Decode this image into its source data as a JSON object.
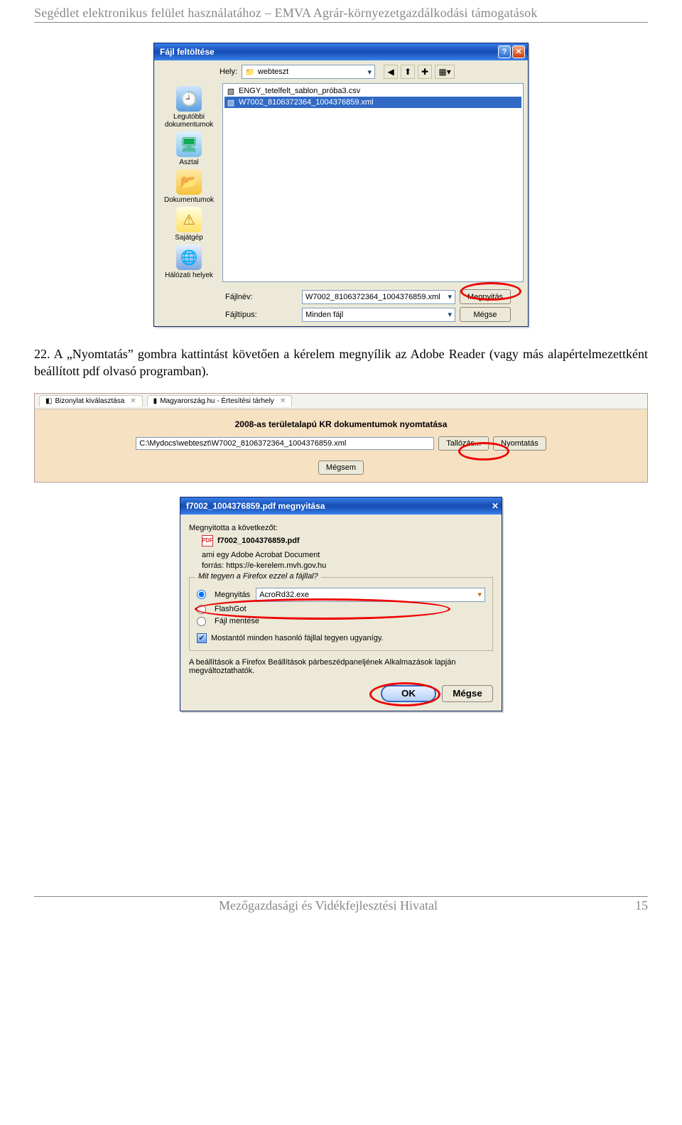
{
  "header": "Segédlet elektronikus felület használatához – EMVA Agrár-környezetgazdálkodási támogatások",
  "paragraph": "22. A „Nyomtatás” gombra kattintást követően a kérelem megnyílik az Adobe Reader (vagy más alapértelmezettként beállított pdf olvasó programban).",
  "footer": {
    "org": "Mezőgazdasági és Vidékfejlesztési Hivatal",
    "page": "15"
  },
  "xp": {
    "title": "Fájl feltöltése",
    "location_label": "Hely:",
    "location_value": "webteszt",
    "places": {
      "recent": "Legutóbbi dokumentumok",
      "desktop": "Asztal",
      "docs": "Dokumentumok",
      "mycomp": "Sajátgép",
      "net": "Hálózati helyek"
    },
    "files": [
      "ENGY_tetelfelt_sablon_próba3.csv",
      "W7002_8106372364_1004376859.xml"
    ],
    "filename_label": "Fájlnév:",
    "filetype_label": "Fájltípus:",
    "filename_value": "W7002_8106372364_1004376859.xml",
    "filetype_value": "Minden fájl",
    "open_btn": "Megnyitás",
    "cancel_btn": "Mégse"
  },
  "web": {
    "tab1": "Bizonylat kiválasztása",
    "tab2": "Magyarország.hu - Értesítési tárhely",
    "title": "2008-as területalapú KR dokumentumok nyomtatása",
    "path": "C:\\Mydocs\\webteszt\\W7002_8106372364_1004376859.xml",
    "browse": "Tallózás...",
    "print": "Nyomtatás",
    "cancel": "Mégsem"
  },
  "ff": {
    "title": "f7002_1004376859.pdf megnyitása",
    "opened_label": "Megnyitotta a következőt:",
    "filename": "f7002_1004376859.pdf",
    "type_prefix": "ami egy",
    "type_value": "Adobe Acrobat Document",
    "source_prefix": "forrás:",
    "source_value": "https://e-kerelem.mvh.gov.hu",
    "legend": "Mit tegyen a Firefox ezzel a fájllal?",
    "open_label": "Megnyitás",
    "open_app": "AcroRd32.exe",
    "flashgot": "FlashGot",
    "save": "Fájl mentése",
    "remember": "Mostantól minden hasonló fájllal tegyen ugyanígy.",
    "settings_note": "A beállítások a Firefox Beállítások párbeszédpaneljének Alkalmazások lapján megváltoztathatók.",
    "ok": "OK",
    "cancel": "Mégse"
  }
}
